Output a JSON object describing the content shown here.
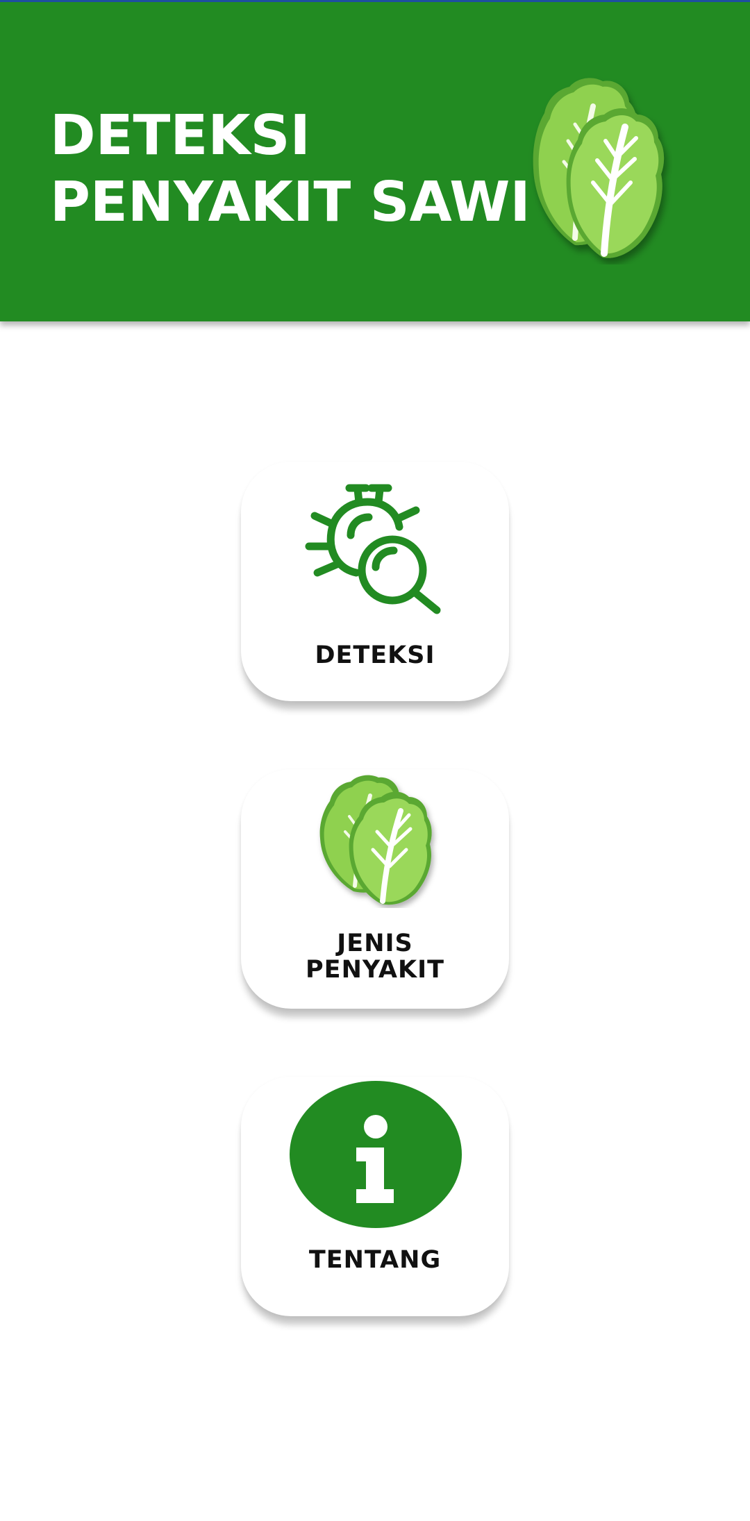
{
  "header": {
    "title_line1": "DETEKSI",
    "title_line2": "PENYAKIT SAWI",
    "background_color": "#228b22",
    "logo_icon": "mustard-greens-icon"
  },
  "menu": {
    "items": [
      {
        "label": "DETEKSI",
        "icon": "bug-search-icon"
      },
      {
        "label_line1": "JENIS",
        "label_line2": "PENYAKIT",
        "icon": "mustard-greens-icon"
      },
      {
        "label": "TENTANG",
        "icon": "info-icon"
      }
    ]
  },
  "colors": {
    "primary": "#228b22",
    "leaf_light": "#8fd14f",
    "leaf_dark": "#5aa832",
    "text_dark": "#111111",
    "background": "#ffffff"
  }
}
